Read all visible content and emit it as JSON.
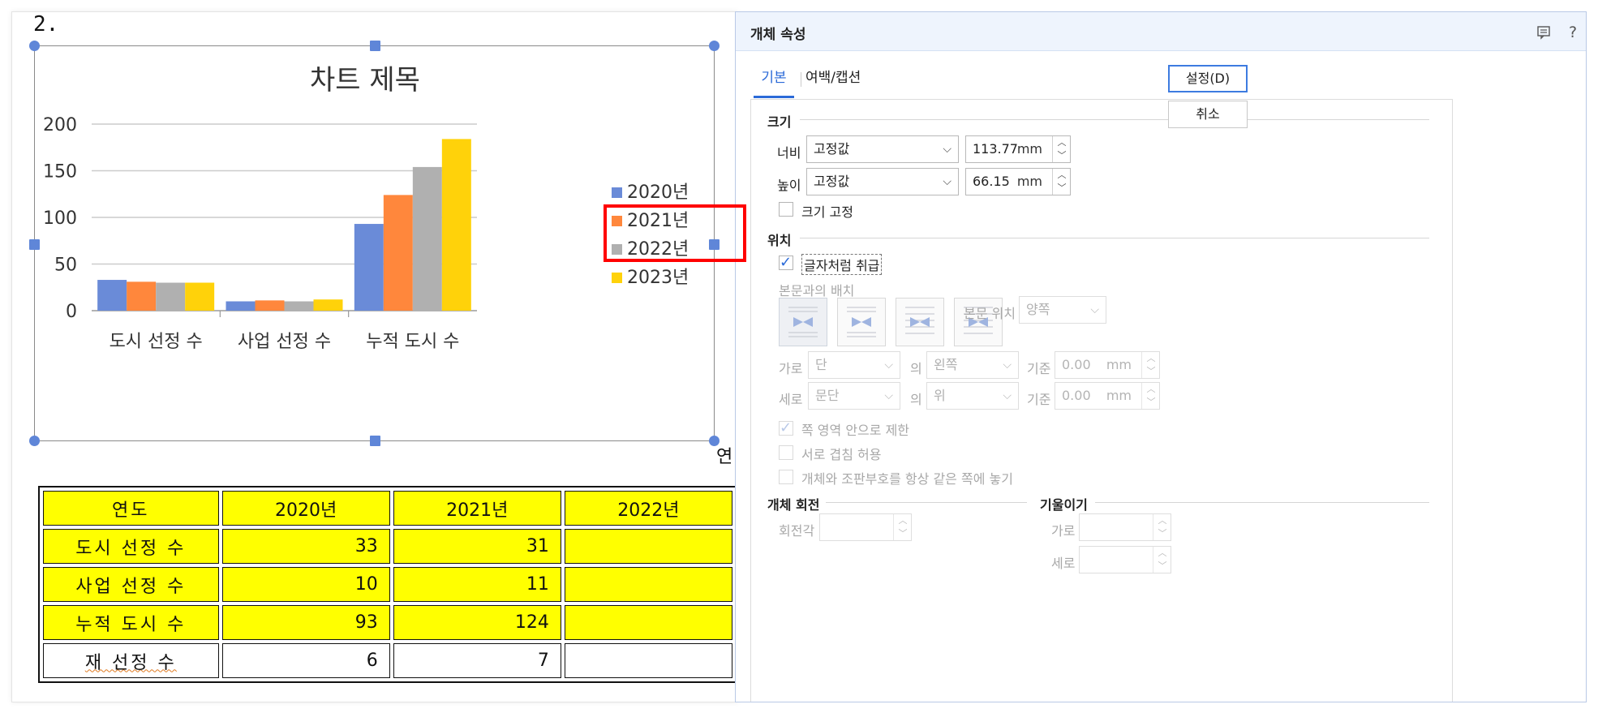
{
  "document": {
    "item_number": "2.",
    "partial_cell_text": "연",
    "table": {
      "header": [
        "연도",
        "2020년",
        "2021년",
        "2022년"
      ],
      "rows": [
        {
          "label": "도시 선정 수",
          "values": [
            "33",
            "31",
            ""
          ]
        },
        {
          "label": "사업 선정 수",
          "values": [
            "10",
            "11",
            ""
          ]
        },
        {
          "label": "누적 도시 수",
          "values": [
            "93",
            "124",
            ""
          ]
        },
        {
          "label": "재 선정 수",
          "values": [
            "6",
            "7",
            ""
          ]
        }
      ]
    }
  },
  "chart_data": {
    "type": "bar",
    "title": "차트 제목",
    "categories": [
      "도시 선정 수",
      "사업 선정 수",
      "누적 도시 수"
    ],
    "series": [
      {
        "name": "2020년",
        "values": [
          33,
          10,
          93
        ],
        "color": "#6a8bd8"
      },
      {
        "name": "2021년",
        "values": [
          31,
          11,
          124
        ],
        "color": "#ff873c"
      },
      {
        "name": "2022년",
        "values": [
          30,
          10,
          154
        ],
        "color": "#b0b0b0"
      },
      {
        "name": "2023년",
        "values": [
          30,
          12,
          184
        ],
        "color": "#ffd20a"
      }
    ],
    "ylim": [
      0,
      200
    ],
    "yticks": [
      "0",
      "50",
      "100",
      "150",
      "200"
    ],
    "grid": true,
    "legend": "right"
  },
  "dialog": {
    "title": "개체 속성",
    "tabs": [
      "기본",
      "여백/캡션"
    ],
    "active_tab": "기본",
    "buttons": {
      "ok": "설정(D)",
      "cancel": "취소"
    },
    "size_section": {
      "title": "크기",
      "width_label": "너비",
      "width_mode": "고정값",
      "width_value": "113.77",
      "height_label": "높이",
      "height_mode": "고정값",
      "height_value": "66.15",
      "unit": "mm",
      "lock_size_label": "크기 고정"
    },
    "position_section": {
      "title": "위치",
      "treat_as_char_label": "글자처럼 취급",
      "wrap_label": "본문과의 배치",
      "text_position_label": "본문 위치",
      "text_position_value": "양쪽",
      "horizontal_label": "가로",
      "horizontal_ref": "단",
      "of_label": "의",
      "horizontal_align": "왼쪽",
      "base_label": "기준",
      "horizontal_offset": "0.00",
      "vertical_label": "세로",
      "vertical_ref": "문단",
      "vertical_align": "위",
      "vertical_offset": "0.00",
      "unit": "mm",
      "option1": "쪽 영역 안으로 제한",
      "option2": "서로 겹침 허용",
      "option3": "개체와 조판부호를 항상 같은 쪽에 놓기"
    },
    "rotation_section": {
      "title": "개체 회전",
      "angle_label": "회전각"
    },
    "skew_section": {
      "title": "기울이기",
      "horizontal_label": "가로",
      "vertical_label": "세로"
    }
  }
}
